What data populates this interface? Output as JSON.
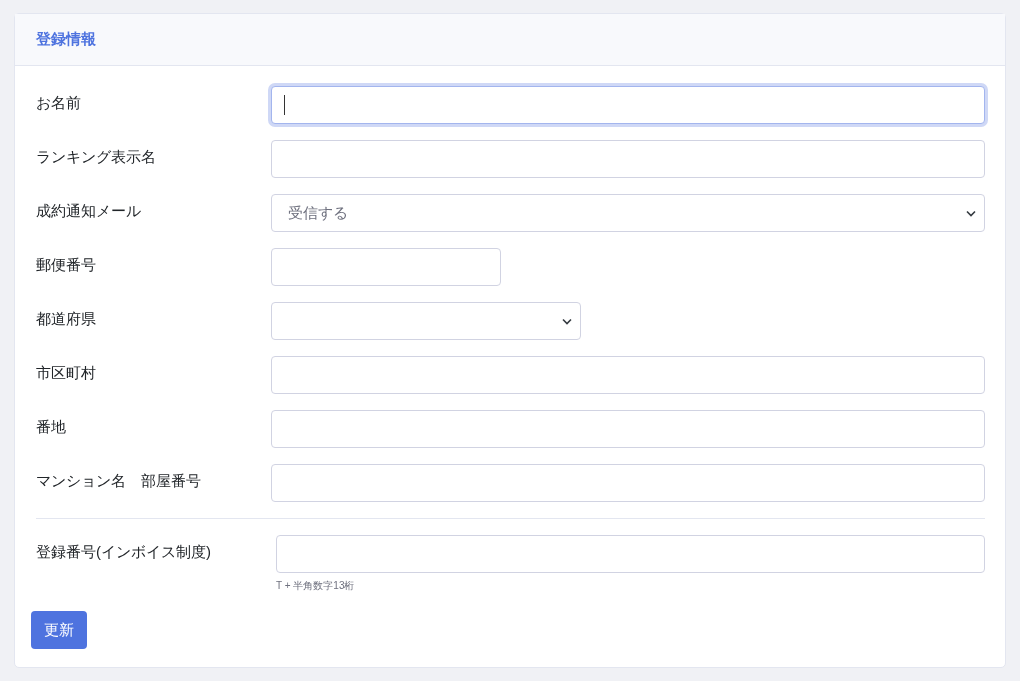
{
  "card": {
    "title": "登録情報"
  },
  "fields": [
    {
      "label": "お名前",
      "kind": "text",
      "focused": true,
      "divider_before": false
    },
    {
      "label": "ランキング表示名",
      "kind": "text",
      "focused": false,
      "divider_before": false
    },
    {
      "label": "成約通知メール",
      "kind": "select",
      "value": "受信する",
      "focused": false,
      "divider_before": false
    },
    {
      "label": "郵便番号",
      "kind": "shorttext",
      "focused": false,
      "divider_before": false
    },
    {
      "label": "都道府県",
      "kind": "shortselect",
      "focused": false,
      "divider_before": false
    },
    {
      "label": "市区町村",
      "kind": "text",
      "focused": false,
      "divider_before": false
    },
    {
      "label": "番地",
      "kind": "text",
      "focused": false,
      "divider_before": false
    },
    {
      "label": "マンション名　部屋番号",
      "kind": "text",
      "focused": false,
      "divider_before": false
    },
    {
      "label": "登録番号(インボイス制度)",
      "kind": "text",
      "focused": false,
      "divider_before": true,
      "hint": "T + 半角数字13桁"
    }
  ],
  "submit": {
    "label": "更新"
  }
}
